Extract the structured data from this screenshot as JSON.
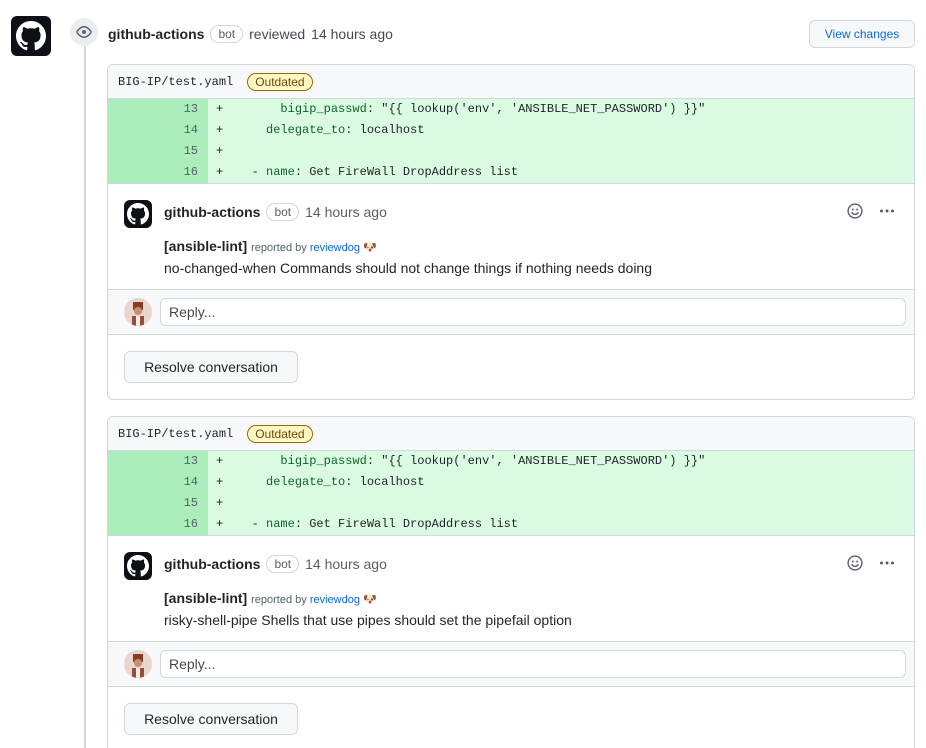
{
  "review": {
    "author": "github-actions",
    "bot_badge": "bot",
    "action": "reviewed",
    "time": "14 hours ago",
    "view_changes": "View changes"
  },
  "threads": [
    {
      "file_path": "BIG-IP/test.yaml",
      "status_badge": "Outdated",
      "diff": [
        {
          "line": "13",
          "sign": "+",
          "indent": "       ",
          "key": "bigip_passwd",
          "rest": ": \"{{ lookup('env', 'ANSIBLE_NET_PASSWORD') }}\""
        },
        {
          "line": "14",
          "sign": "+",
          "indent": "     ",
          "key": "delegate_to",
          "rest": ": localhost"
        },
        {
          "line": "15",
          "sign": "+",
          "indent": "",
          "key": "",
          "rest": ""
        },
        {
          "line": "16",
          "sign": "+",
          "indent": "   - ",
          "key": "name",
          "rest": ": Get FireWall DropAddress list"
        }
      ],
      "comment": {
        "author": "github-actions",
        "bot_badge": "bot",
        "time": "14 hours ago",
        "tag": "[ansible-lint]",
        "reported_by": "reported by",
        "reporter": "reviewdog",
        "message": "no-changed-when Commands should not change things if nothing needs doing"
      },
      "reply_placeholder": "Reply...",
      "resolve_label": "Resolve conversation"
    },
    {
      "file_path": "BIG-IP/test.yaml",
      "status_badge": "Outdated",
      "diff": [
        {
          "line": "13",
          "sign": "+",
          "indent": "       ",
          "key": "bigip_passwd",
          "rest": ": \"{{ lookup('env', 'ANSIBLE_NET_PASSWORD') }}\""
        },
        {
          "line": "14",
          "sign": "+",
          "indent": "     ",
          "key": "delegate_to",
          "rest": ": localhost"
        },
        {
          "line": "15",
          "sign": "+",
          "indent": "",
          "key": "",
          "rest": ""
        },
        {
          "line": "16",
          "sign": "+",
          "indent": "   - ",
          "key": "name",
          "rest": ": Get FireWall DropAddress list"
        }
      ],
      "comment": {
        "author": "github-actions",
        "bot_badge": "bot",
        "time": "14 hours ago",
        "tag": "[ansible-lint]",
        "reported_by": "reported by",
        "reporter": "reviewdog",
        "message": "risky-shell-pipe Shells that use pipes should set the pipefail option"
      },
      "reply_placeholder": "Reply...",
      "resolve_label": "Resolve conversation"
    }
  ],
  "colors": {
    "added_line_bg": "#dafbe1",
    "added_number_bg": "#aceebb",
    "link": "#0969da",
    "outdated_border": "#9a6700"
  },
  "icons": [
    "github-icon",
    "eye-icon",
    "smiley-icon",
    "kebab-horizontal-icon",
    "dog-emoji-icon"
  ]
}
